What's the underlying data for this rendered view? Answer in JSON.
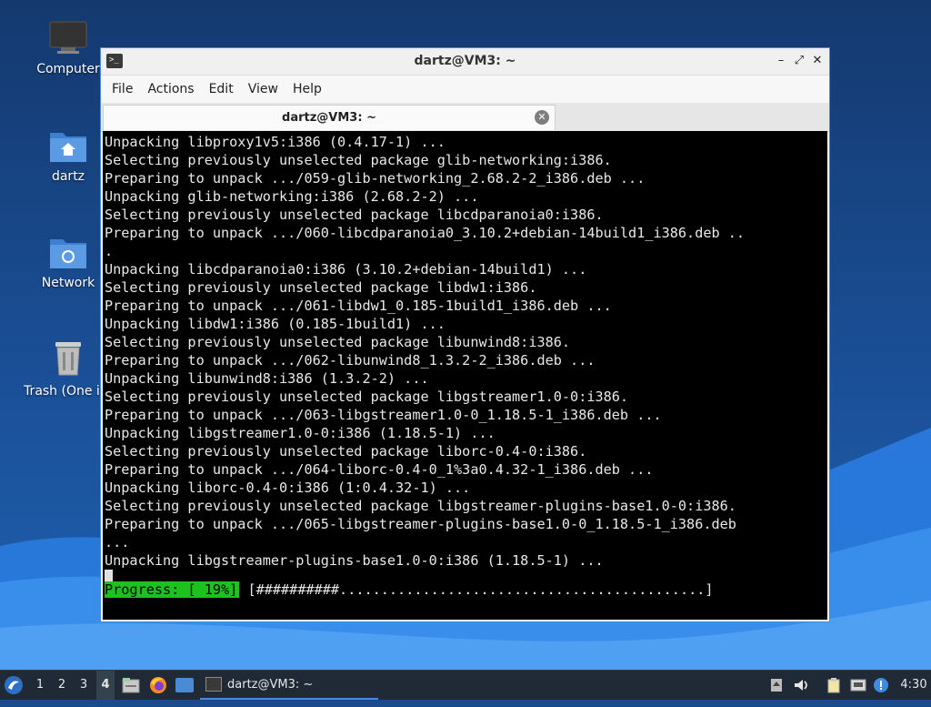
{
  "desktop": {
    "icons": [
      {
        "label": "Computer"
      },
      {
        "label": "dartz"
      },
      {
        "label": "Network"
      },
      {
        "label": "Trash (One ite"
      }
    ]
  },
  "window": {
    "title": "dartz@VM3: ~",
    "menu": [
      "File",
      "Actions",
      "Edit",
      "View",
      "Help"
    ],
    "tab_label": "dartz@VM3: ~",
    "terminal_lines": [
      "Unpacking libproxy1v5:i386 (0.4.17-1) ...",
      "Selecting previously unselected package glib-networking:i386.",
      "Preparing to unpack .../059-glib-networking_2.68.2-2_i386.deb ...",
      "Unpacking glib-networking:i386 (2.68.2-2) ...",
      "Selecting previously unselected package libcdparanoia0:i386.",
      "Preparing to unpack .../060-libcdparanoia0_3.10.2+debian-14build1_i386.deb ..",
      ".",
      "Unpacking libcdparanoia0:i386 (3.10.2+debian-14build1) ...",
      "Selecting previously unselected package libdw1:i386.",
      "Preparing to unpack .../061-libdw1_0.185-1build1_i386.deb ...",
      "Unpacking libdw1:i386 (0.185-1build1) ...",
      "Selecting previously unselected package libunwind8:i386.",
      "Preparing to unpack .../062-libunwind8_1.3.2-2_i386.deb ...",
      "Unpacking libunwind8:i386 (1.3.2-2) ...",
      "Selecting previously unselected package libgstreamer1.0-0:i386.",
      "Preparing to unpack .../063-libgstreamer1.0-0_1.18.5-1_i386.deb ...",
      "Unpacking libgstreamer1.0-0:i386 (1.18.5-1) ...",
      "Selecting previously unselected package liborc-0.4-0:i386.",
      "Preparing to unpack .../064-liborc-0.4-0_1%3a0.4.32-1_i386.deb ...",
      "Unpacking liborc-0.4-0:i386 (1:0.4.32-1) ...",
      "Selecting previously unselected package libgstreamer-plugins-base1.0-0:i386.",
      "Preparing to unpack .../065-libgstreamer-plugins-base1.0-0_1.18.5-1_i386.deb",
      "...",
      "Unpacking libgstreamer-plugins-base1.0-0:i386 (1.18.5-1) ..."
    ],
    "progress_label": "Progress: [ 19%]",
    "progress_bar": "[##########............................................]",
    "progress_percent": 19
  },
  "taskbar": {
    "workspaces": [
      "1",
      "2",
      "3",
      "4"
    ],
    "active_workspace": "4",
    "task_label": "dartz@VM3: ~",
    "clock": "4:30"
  },
  "colors": {
    "progress_green": "#1ec21e",
    "window_border": "#4a8bd6",
    "taskbar_bg": "#1f2a36"
  }
}
